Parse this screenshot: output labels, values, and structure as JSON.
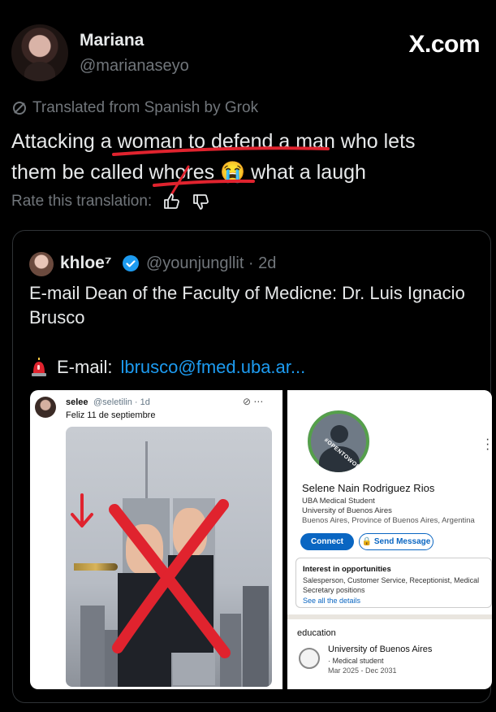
{
  "watermark": "X.com",
  "author": {
    "name": "Mariana",
    "handle": "@marianaseyo"
  },
  "translation": {
    "notice": "Translated from Spanish by Grok",
    "rate_label": "Rate this translation:"
  },
  "post": {
    "text_line1": "Attacking a woman to defend a man who lets",
    "text_line2": "them be called whores 😭 what a laugh"
  },
  "quote": {
    "name": "khloe⁷",
    "handle_time": "@younjungllit · 2d",
    "text": "E-mail Dean of the Faculty of Medicne: Dr. Luis Ignacio Brusco",
    "email_prefix": "E-mail:",
    "email_link": "lbrusco@fmed.uba.ar..."
  },
  "image_left": {
    "name": "selee",
    "handle_time": "@seletilin · 1d",
    "caption": "Feliz 11 de septiembre"
  },
  "image_right": {
    "badge": "#OPENTOWORK",
    "name": "Selene Nain Rodriguez Rios",
    "sub1": "UBA Medical Student",
    "sub2": "University of Buenos Aires",
    "sub3": "Buenos Aires, Province of Buenos Aires, Argentina",
    "connect": "Connect",
    "send_message": "Send Message",
    "interest_title": "Interest in opportunities",
    "interest_roles": "Salesperson, Customer Service, Receptionist, Medical Secretary positions",
    "see_details": "See all the details",
    "education_label": "education",
    "university": "University of Buenos Aires",
    "degree": "· Medical student",
    "dates": "Mar 2025 - Dec 2031"
  },
  "colors": {
    "link": "#1d9bf0",
    "muted": "#71767b",
    "annotation_red": "#e0232e",
    "linkedin_blue": "#0a66c2"
  },
  "icons": [
    "translate-icon",
    "thumbs-up-icon",
    "thumbs-down-icon",
    "verified-badge-icon",
    "siren-icon",
    "red-arrow-icon",
    "red-x-icon"
  ]
}
